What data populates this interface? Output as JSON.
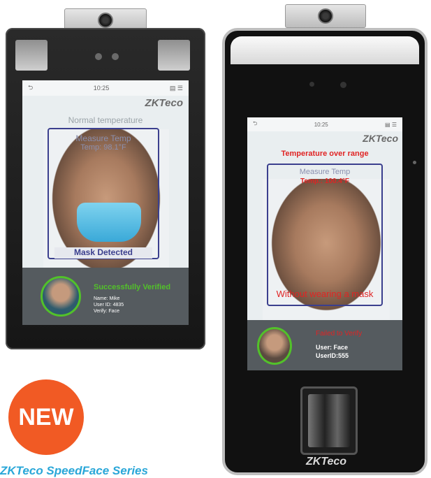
{
  "badge": {
    "label": "NEW"
  },
  "caption": {
    "text": "ZKTeco SpeedFace Series"
  },
  "device_left": {
    "time": "10:25",
    "brand": "ZKTeco",
    "status_title": "Normal temperature",
    "measure_label": "Measure Temp",
    "temp_reading": "Temp: 98.1°F",
    "mask_status": "Mask Detected",
    "verify_result": "Successfully Verified",
    "name_line": "Name: Mike",
    "user_id_line": "User ID: 4835",
    "verify_line": "Verify: Face"
  },
  "device_right": {
    "time": "10:25",
    "brand": "ZKTeco",
    "status_title": "Temperature over range",
    "measure_label": "Measure Temp",
    "temp_reading": "Temp.: 100.4°F",
    "mask_warning": "Without wearing a mask",
    "verify_result": "Failed to Verify",
    "user_line": "User: Face",
    "userid_line": "UserID:555",
    "bottom_brand": "ZKTeco"
  },
  "colors": {
    "accent_green": "#52c12a",
    "alert_red": "#e02424",
    "frame_blue": "#3b3f8e",
    "badge_orange": "#f15a24",
    "caption_blue": "#2aa7d8"
  }
}
